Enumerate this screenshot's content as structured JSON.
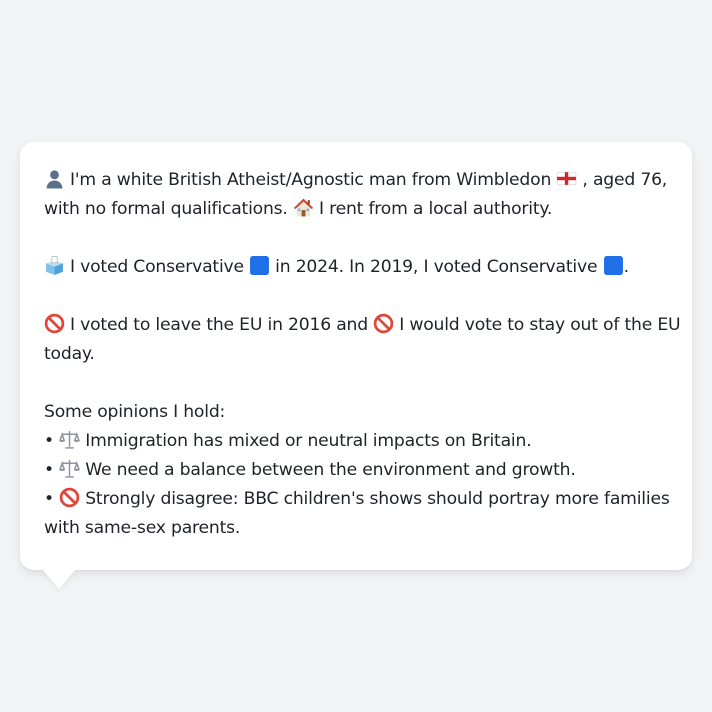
{
  "profile": {
    "identity": {
      "icon": "person-silhouette-icon",
      "text_a": "I'm a white British Atheist/Agnostic man from Wimbledon",
      "flag": "england-flag-icon",
      "text_b": ", aged 76,",
      "text_c": "with no formal qualifications.",
      "house_icon": "house-icon",
      "text_d": "I rent from a local authority."
    },
    "voting": {
      "icon": "ballot-box-icon",
      "text_a": "I voted Conservative",
      "party_icon": "blue-square-icon",
      "text_b": "in 2024. In 2019, I voted Conservative",
      "text_c": "."
    },
    "eu": {
      "icon": "no-entry-icon",
      "text_a": "I voted to leave the EU in 2016 and",
      "text_b": "I would vote to stay out of the EU",
      "text_c": "today."
    },
    "opinions": {
      "heading": "Some opinions I hold:",
      "bullet": "•",
      "items": [
        {
          "icon": "balance-scale-icon",
          "text": "Immigration has mixed or neutral impacts on Britain."
        },
        {
          "icon": "balance-scale-icon",
          "text": "We need a balance between the environment and growth."
        },
        {
          "icon": "no-entry-icon",
          "text": "Strongly disagree: BBC children's shows should portray more families",
          "text_cont": "with same-sex parents."
        }
      ]
    }
  },
  "colors": {
    "background": "#f2f3f5",
    "card": "#ffffff",
    "text": "#1f2328",
    "party_blue": "#1e6fe8",
    "no_entry_red": "#e0453a"
  }
}
